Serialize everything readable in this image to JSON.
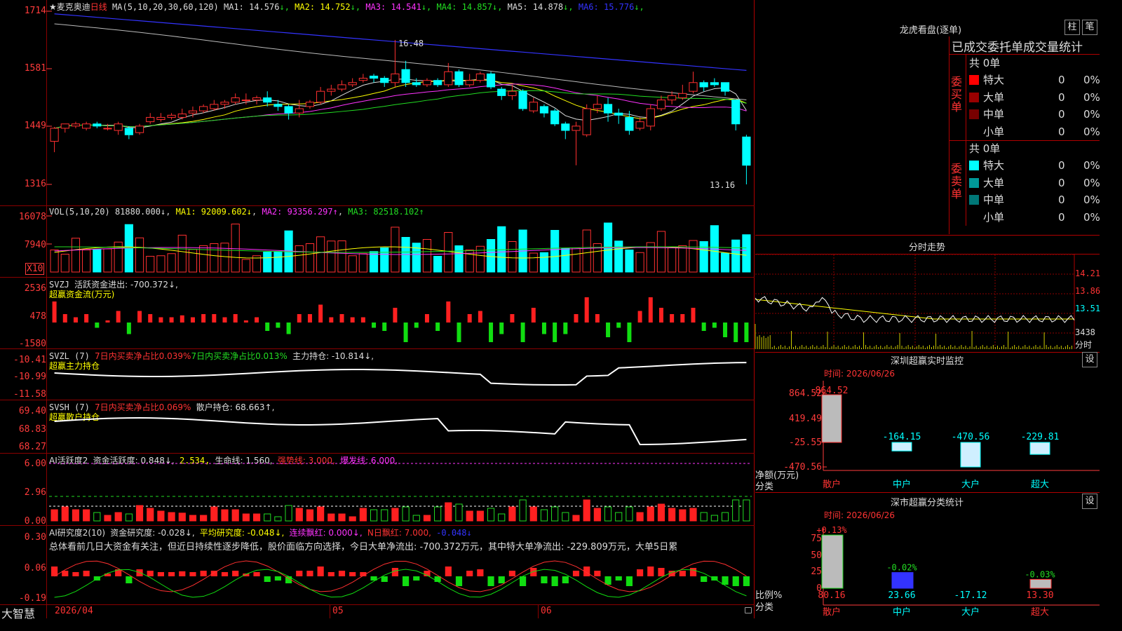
{
  "stock": {
    "name": "麦克奥迪",
    "period": "日线",
    "ma_params": "MA(5,10,20,30,60,120)"
  },
  "main": {
    "ma_values": [
      {
        "label": "MA1: 14.576",
        "arrow": "↓",
        "color": "#dddddd"
      },
      {
        "label": "MA2: 14.752",
        "arrow": "↓",
        "color": "#ffff00"
      },
      {
        "label": "MA3: 14.541",
        "arrow": "↓",
        "color": "#ff33ff"
      },
      {
        "label": "MA4: 14.857",
        "arrow": "↓",
        "color": "#22dd22"
      },
      {
        "label": "MA5: 14.878",
        "arrow": "↓",
        "color": "#dddddd"
      },
      {
        "label": "MA6: 15.776",
        "arrow": "↓",
        "color": "#3333ff"
      }
    ],
    "yticks": [
      "1714",
      "1581",
      "1449",
      "1316"
    ],
    "high_label": "16.48",
    "low_label": "13.16"
  },
  "vol": {
    "header_prefix": "VOL(5,10,20)",
    "value": "81880.000↓",
    "ma1": "MA1: 92009.602↓",
    "ma2": "MA2: 93356.297↑",
    "ma3": "MA3: 82518.102↑",
    "yticks": [
      "16078",
      "7940"
    ],
    "unit": "X10"
  },
  "svzj": {
    "name": "SVZJ",
    "label": "活跃资金进出: -700.372↓,",
    "sub": "超赢资金流(万元)",
    "yticks": [
      "2536",
      "478",
      "-1580"
    ]
  },
  "svzl": {
    "name": "SVZL (7)",
    "p1": "7日内买卖净占比0.039%",
    "p2": "7日内买卖净占比0.013%",
    "p3": "主力持仓: -10.814↓,",
    "sub": "超赢主力持仓",
    "yticks": [
      "-10.41",
      "-10.99",
      "-11.58"
    ]
  },
  "svsh": {
    "name": "SVSH (7)",
    "p1": "7日内买卖净占比0.069%",
    "p2": "散户持仓: 68.663↑,",
    "sub": "超赢散户持仓",
    "yticks": [
      "69.40",
      "68.83",
      "68.27"
    ]
  },
  "ai1": {
    "name": "AI活跃度2",
    "p1": "资金活跃度: 0.848↓,",
    "p2": "2.534,",
    "p3": "生命线: 1.560,",
    "p4": "强势线: 3.000,",
    "p5": "爆发线: 6.000,",
    "yticks": [
      "6.00",
      "2.96",
      "0.00"
    ]
  },
  "ai2": {
    "name": "AI研究度2(10)",
    "p1": "资金研究度: -0.028↓,",
    "p2": "平均研究度: -0.048↓,",
    "p3": "连续飘红: 0.000↓,",
    "p4": "N日飘红: 7.000,",
    "p5": "-0.048↓",
    "summary": "总体看前几日大资金有关注，但近日持续性逐步降低，股价面临方向选择，今日大单净流出: -700.372万元，其中特大单净流出: -229.809万元，大单5日累",
    "yticks": [
      "0.30",
      "0.06",
      "-0.19"
    ]
  },
  "xaxis": {
    "labels": [
      "2026/04",
      "05",
      "06"
    ],
    "brand": "大智慧"
  },
  "lhb": {
    "title": "龙虎看盘(逐单)",
    "btn1": "柱",
    "btn2": "笔",
    "subtitle": "已成交委托单成交量统计",
    "buy": {
      "side": "委买单",
      "total": "共 0单",
      "rows": [
        {
          "name": "特大",
          "color": "#ff0000",
          "n": "0",
          "p": "0%"
        },
        {
          "name": "大单",
          "color": "#990000",
          "n": "0",
          "p": "0%"
        },
        {
          "name": "中单",
          "color": "#770000",
          "n": "0",
          "p": "0%"
        },
        {
          "name": "小单",
          "color": "#000000",
          "n": "0",
          "p": "0%"
        }
      ]
    },
    "sell": {
      "side": "委卖单",
      "total": "共 0单",
      "rows": [
        {
          "name": "特大",
          "color": "#00ffff",
          "n": "0",
          "p": "0%"
        },
        {
          "name": "大单",
          "color": "#009999",
          "n": "0",
          "p": "0%"
        },
        {
          "name": "中单",
          "color": "#007777",
          "n": "0",
          "p": "0%"
        },
        {
          "name": "小单",
          "color": "#000000",
          "n": "0",
          "p": "0%"
        }
      ]
    }
  },
  "intraday": {
    "title": "分时走势",
    "prices": [
      "14.21",
      "13.86",
      "13.51"
    ],
    "vol": "3438",
    "unit": "分时"
  },
  "sz_monitor": {
    "title": "深圳超赢实时监控",
    "btn": "设",
    "time": "时间: 2026/06/26",
    "yticks": [
      "864.52",
      "419.49",
      "-25.55",
      "-470.56"
    ],
    "ylabel": "净额(万元)",
    "xlabel": "分类",
    "bars": [
      {
        "cat": "散户",
        "value": 864.52,
        "label": "864.52"
      },
      {
        "cat": "中户",
        "value": -164.15,
        "label": "-164.15"
      },
      {
        "cat": "大户",
        "value": -470.56,
        "label": "-470.56"
      },
      {
        "cat": "超大",
        "value": -229.81,
        "label": "-229.81"
      }
    ]
  },
  "sz_class": {
    "title": "深市超赢分类统计",
    "btn": "设",
    "time": "时间: 2026/06/26",
    "yticks": [
      "75",
      "50",
      "25",
      "0"
    ],
    "ylabel": "比例%",
    "xlabel": "分类",
    "bars": [
      {
        "cat": "散户",
        "value": 80.16,
        "label": "80.16",
        "delta": "+0.13%"
      },
      {
        "cat": "中户",
        "value": 23.66,
        "label": "23.66",
        "delta": "-0.02%"
      },
      {
        "cat": "大户",
        "value": -17.12,
        "label": "-17.12",
        "delta": ""
      },
      {
        "cat": "超大",
        "value": 13.3,
        "label": "13.30",
        "delta": "-0.03%"
      }
    ]
  },
  "chart_data": {
    "type": "candlestick",
    "ohlc": [
      [
        14.15,
        14.45,
        13.9,
        14.48
      ],
      [
        14.45,
        14.55,
        14.35,
        14.55
      ],
      [
        14.5,
        14.55,
        14.45,
        14.6
      ],
      [
        14.45,
        14.55,
        14.4,
        14.6
      ],
      [
        14.55,
        14.5,
        14.45,
        14.6
      ],
      [
        14.45,
        14.45,
        14.4,
        14.55
      ],
      [
        14.4,
        14.55,
        14.3,
        14.6
      ],
      [
        14.45,
        14.3,
        14.2,
        14.5
      ],
      [
        14.35,
        14.5,
        14.3,
        14.55
      ],
      [
        14.6,
        14.7,
        14.55,
        14.8
      ],
      [
        14.65,
        14.7,
        14.6,
        14.8
      ],
      [
        14.7,
        14.75,
        14.65,
        14.8
      ],
      [
        14.7,
        14.78,
        14.65,
        14.9
      ],
      [
        14.8,
        14.85,
        14.7,
        14.95
      ],
      [
        14.85,
        14.95,
        14.8,
        15.0
      ],
      [
        14.9,
        15.0,
        14.85,
        15.1
      ],
      [
        15.0,
        15.05,
        14.9,
        15.1
      ],
      [
        15.05,
        15.15,
        15.0,
        15.25
      ],
      [
        15.1,
        15.1,
        15.0,
        15.25
      ],
      [
        15.1,
        15.15,
        15.0,
        15.2
      ],
      [
        15.15,
        15.05,
        14.95,
        15.3
      ],
      [
        15.0,
        14.95,
        14.85,
        15.1
      ],
      [
        14.95,
        14.8,
        14.65,
        15.0
      ],
      [
        14.8,
        14.9,
        14.7,
        15.1
      ],
      [
        14.95,
        15.05,
        14.9,
        15.1
      ],
      [
        15.05,
        15.3,
        15.0,
        15.4
      ],
      [
        15.3,
        15.35,
        15.2,
        15.45
      ],
      [
        15.35,
        15.45,
        15.3,
        15.55
      ],
      [
        15.45,
        15.5,
        15.4,
        15.6
      ],
      [
        15.55,
        15.6,
        15.5,
        15.7
      ],
      [
        15.65,
        15.6,
        15.5,
        15.7
      ],
      [
        15.6,
        15.5,
        15.4,
        15.65
      ],
      [
        15.5,
        15.7,
        15.4,
        16.48
      ],
      [
        15.8,
        15.5,
        15.4,
        16.0
      ],
      [
        15.5,
        15.45,
        15.4,
        15.6
      ],
      [
        15.45,
        15.55,
        15.4,
        15.6
      ],
      [
        15.55,
        15.45,
        15.4,
        15.6
      ],
      [
        15.45,
        15.75,
        15.4,
        15.95
      ],
      [
        15.75,
        15.45,
        15.4,
        15.8
      ],
      [
        15.45,
        15.55,
        15.4,
        15.7
      ],
      [
        15.55,
        15.7,
        15.5,
        15.75
      ],
      [
        15.7,
        15.4,
        15.35,
        15.75
      ],
      [
        15.35,
        15.2,
        15.1,
        15.4
      ],
      [
        15.2,
        15.3,
        15.1,
        15.45
      ],
      [
        15.3,
        14.9,
        14.85,
        15.35
      ],
      [
        14.85,
        15.05,
        14.8,
        15.15
      ],
      [
        14.95,
        14.8,
        14.7,
        15.0
      ],
      [
        14.85,
        14.55,
        14.5,
        14.9
      ],
      [
        14.55,
        14.4,
        14.2,
        14.6
      ],
      [
        14.4,
        14.5,
        13.6,
        14.6
      ],
      [
        14.3,
        14.9,
        14.25,
        15.0
      ],
      [
        14.9,
        15.0,
        14.8,
        15.2
      ],
      [
        15.0,
        14.8,
        14.6,
        15.15
      ],
      [
        14.8,
        14.75,
        14.55,
        14.9
      ],
      [
        14.7,
        14.4,
        14.3,
        14.85
      ],
      [
        14.45,
        14.6,
        14.4,
        14.7
      ],
      [
        14.5,
        14.9,
        14.4,
        15.0
      ],
      [
        14.9,
        15.1,
        14.85,
        15.2
      ],
      [
        15.1,
        15.2,
        15.0,
        15.3
      ],
      [
        15.15,
        15.25,
        15.1,
        15.45
      ],
      [
        15.3,
        15.5,
        15.25,
        15.75
      ],
      [
        15.5,
        15.4,
        15.3,
        15.55
      ],
      [
        15.5,
        15.45,
        15.4,
        15.6
      ],
      [
        15.5,
        15.3,
        15.2,
        15.5
      ],
      [
        15.1,
        14.55,
        14.4,
        15.1
      ],
      [
        14.25,
        13.6,
        13.16,
        14.3
      ]
    ]
  }
}
